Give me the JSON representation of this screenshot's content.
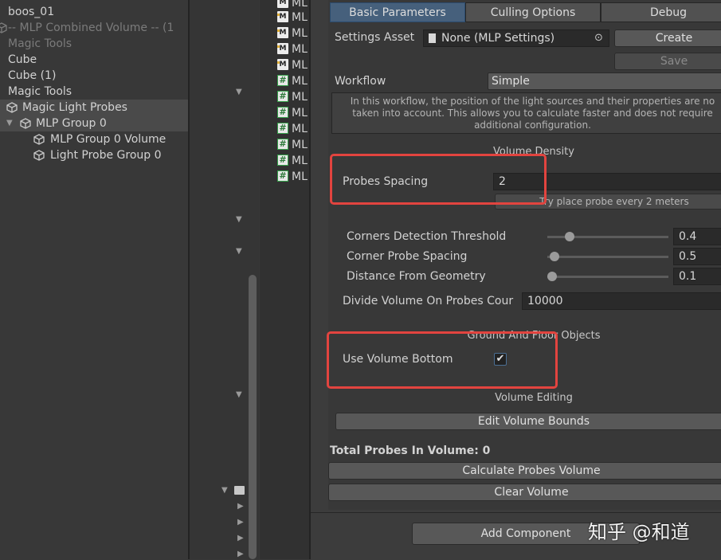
{
  "hierarchy": {
    "rows": [
      {
        "label": "boos_01",
        "dim": false,
        "icon": false
      },
      {
        "label": "-- MLP Combined Volume -- (1",
        "dim": true,
        "icon": true
      },
      {
        "label": "Magic Tools",
        "dim": true,
        "icon": false
      },
      {
        "label": "Cube",
        "dim": false,
        "icon": true
      },
      {
        "label": "Cube (1)",
        "dim": false,
        "icon": true
      },
      {
        "label": "Magic Tools",
        "dim": false,
        "icon": true
      },
      {
        "label": "Magic Light Probes",
        "dim": false,
        "icon": true
      },
      {
        "label": "MLP Group 0",
        "dim": false,
        "icon": true
      },
      {
        "label": "MLP Group 0 Volume",
        "dim": false,
        "icon": true
      },
      {
        "label": "Light Probe Group 0",
        "dim": false,
        "icon": true
      }
    ]
  },
  "project": {
    "files": [
      "ML",
      "ML",
      "ML",
      "ML",
      "ML",
      "ML",
      "ML",
      "ML",
      "ML",
      "ML",
      "ML",
      "ML"
    ]
  },
  "inspector": {
    "tabs": [
      "Basic Parameters",
      "Culling Options",
      "Debug"
    ],
    "settings_asset_label": "Settings Asset",
    "settings_asset_value": "None (MLP Settings)",
    "create_label": "Create",
    "save_label": "Save",
    "workflow_label": "Workflow",
    "workflow_value": "Simple",
    "help_text_1": "In this workflow, the position of the light sources and their properties are no",
    "help_text_2": "taken into account. This allows you to calculate faster and does not require",
    "help_text_3": "additional configuration.",
    "volume_density_header": "Volume Density",
    "probes_spacing_label": "Probes Spacing",
    "probes_spacing_value": "2",
    "probes_spacing_hint": "Try place probe every 2 meters",
    "corners_threshold_label": "Corners Detection Threshold",
    "corners_threshold_value": "0.4",
    "corner_probe_spacing_label": "Corner Probe Spacing",
    "corner_probe_spacing_value": "0.5",
    "distance_geometry_label": "Distance From Geometry",
    "distance_geometry_value": "0.1",
    "divide_volume_label": "Divide Volume On Probes Cour",
    "divide_volume_value": "10000",
    "ground_header": "Ground And Floor Objects",
    "use_volume_bottom_label": "Use Volume Bottom",
    "use_volume_bottom_checked": "✔",
    "volume_editing_header": "Volume Editing",
    "edit_volume_bounds_label": "Edit Volume Bounds",
    "total_probes_label": "Total Probes In Volume: 0",
    "calculate_label": "Calculate Probes Volume",
    "clear_label": "Clear Volume",
    "add_component_label": "Add Component"
  },
  "watermark": "知乎 @和道",
  "colors": {
    "highlight_box": "#e2443f",
    "active_tab": "#46607c",
    "panel_bg": "#383838"
  }
}
